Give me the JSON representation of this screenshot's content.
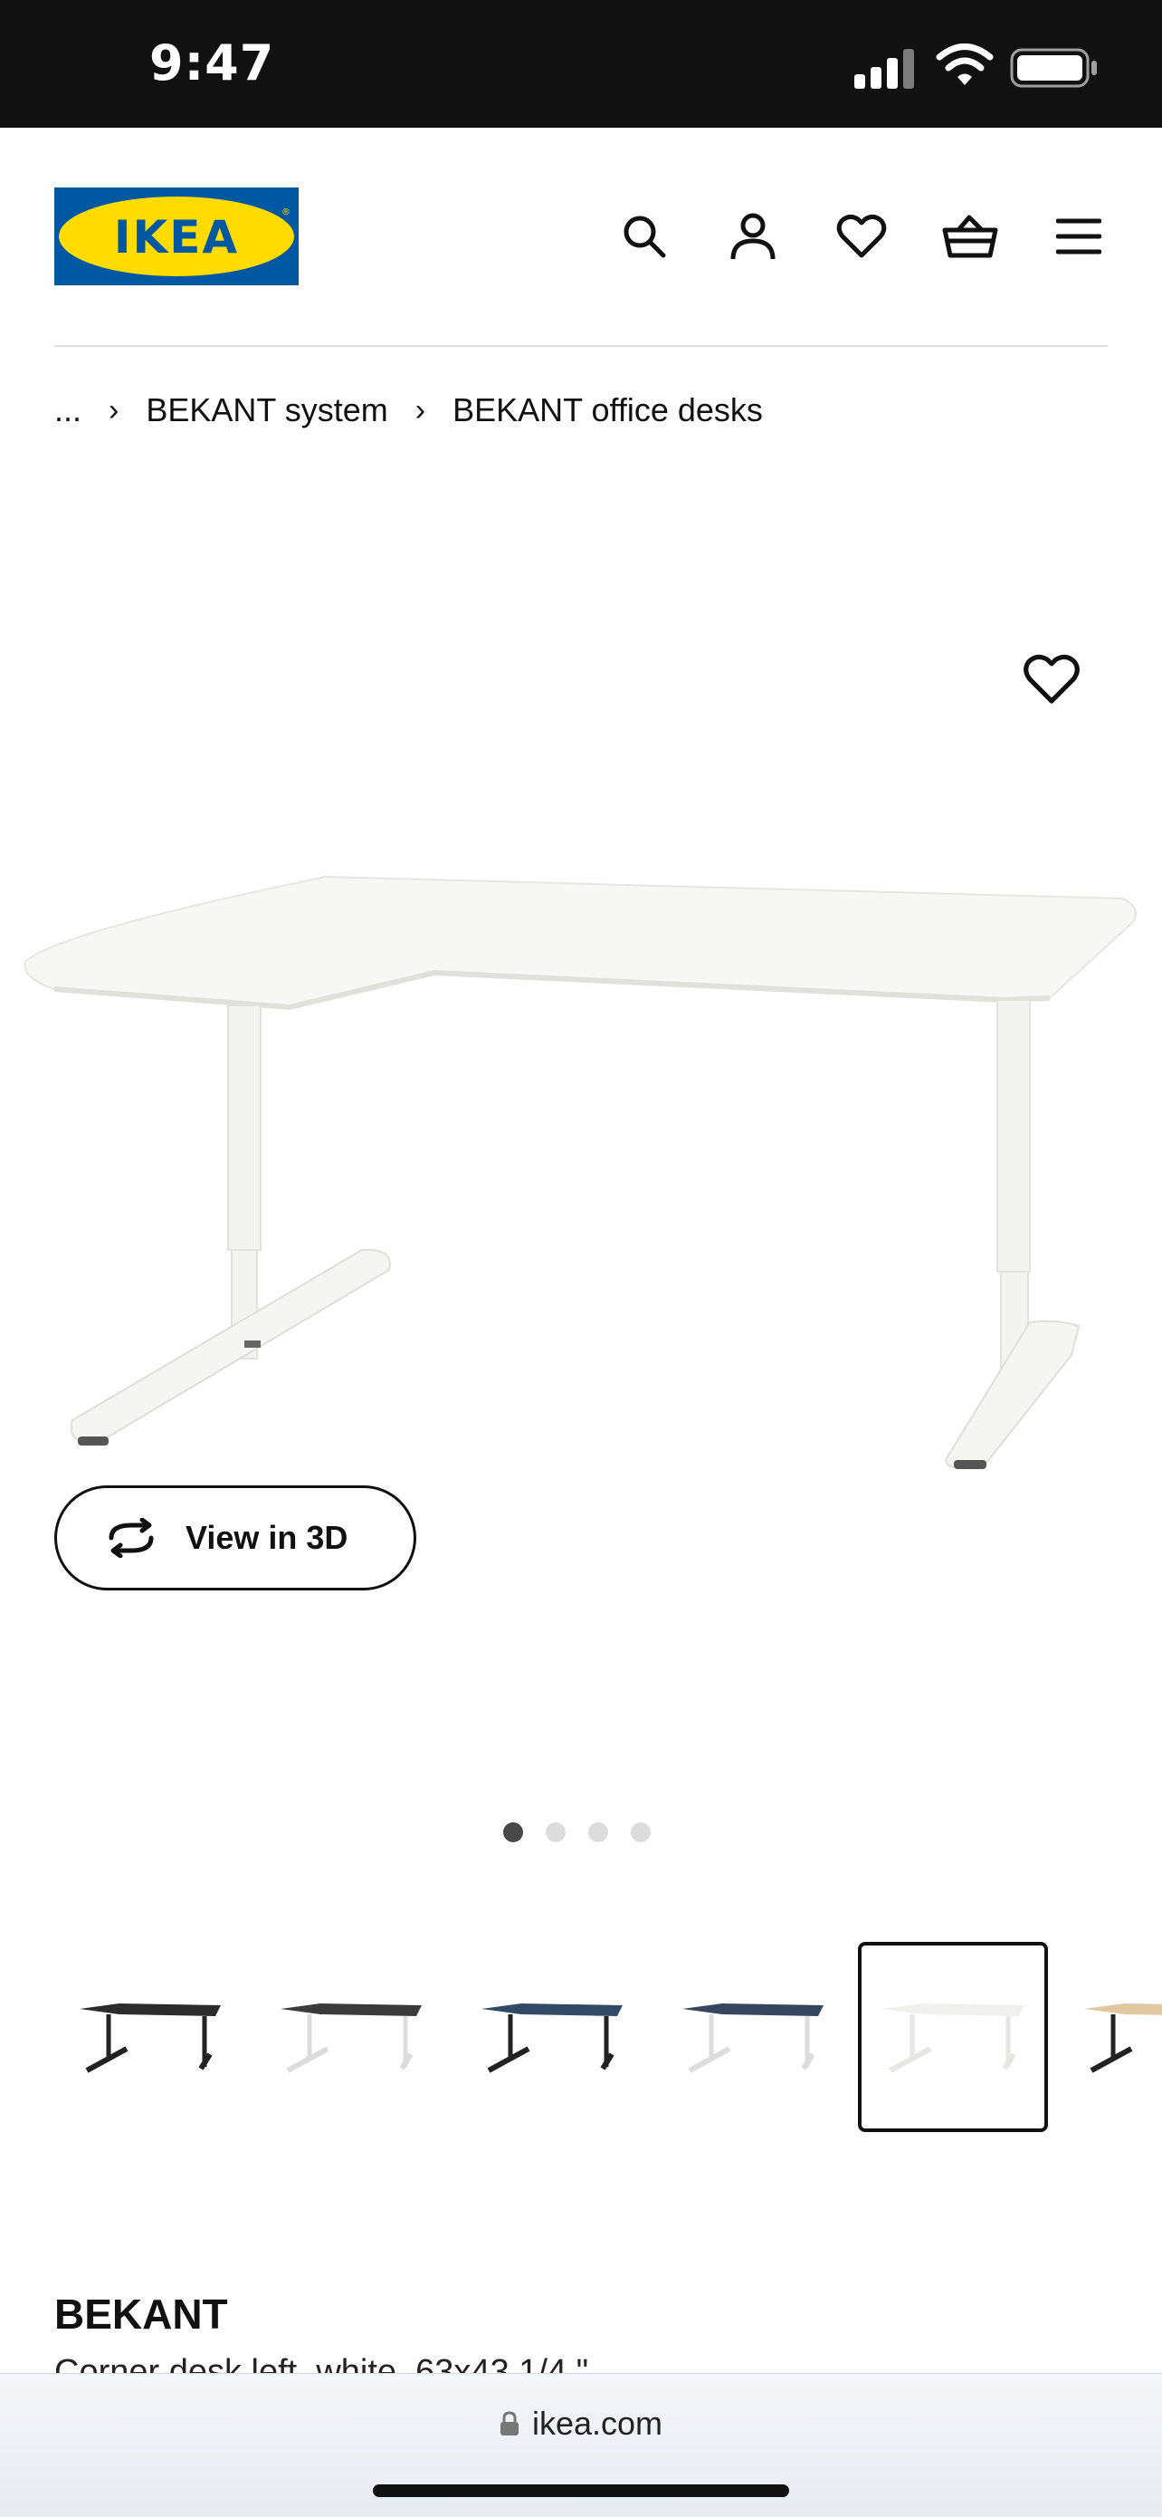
{
  "status_bar": {
    "time": "9:47"
  },
  "header": {
    "logo_text": "IKEA",
    "icons": [
      "search-icon",
      "account-icon",
      "favourites-icon",
      "basket-icon",
      "menu-icon"
    ]
  },
  "breadcrumb": {
    "ellipsis": "...",
    "items": [
      "BEKANT system",
      "BEKANT office desks"
    ]
  },
  "gallery": {
    "view_3d_label": "View in 3D",
    "dots": 4,
    "active_dot": 1
  },
  "thumbnails": {
    "selected_index": 4,
    "colors": [
      "black",
      "black-white",
      "blue-black",
      "blue-white",
      "white",
      "oak-black"
    ]
  },
  "product": {
    "name": "BEKANT",
    "subtitle": "Corner desk left, white, 63x43 1/4 \""
  },
  "browser": {
    "url": "ikea.com"
  },
  "colors": {
    "ikea_blue": "#0058a3",
    "ikea_yellow": "#ffdb00",
    "status_bar_bg": "#111111"
  }
}
